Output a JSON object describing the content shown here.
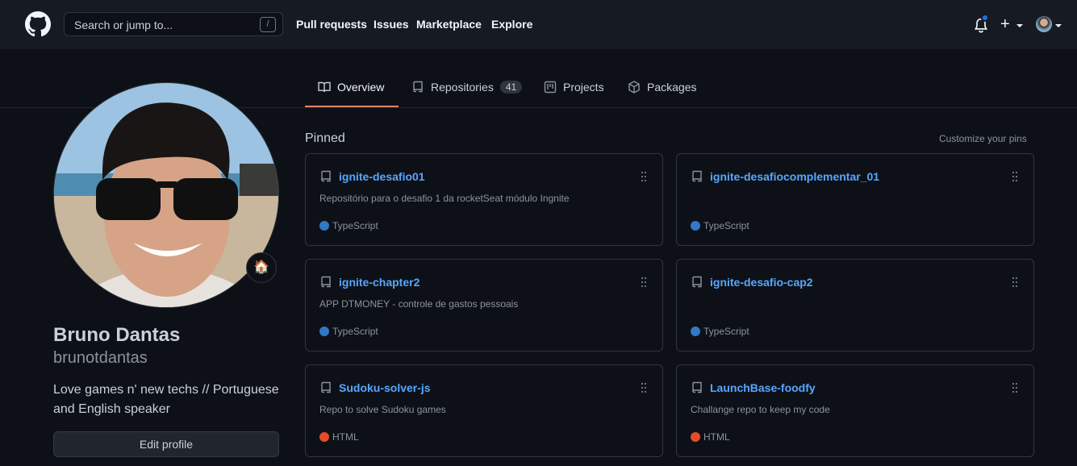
{
  "header": {
    "search_placeholder": "Search or jump to...",
    "search_shortcut": "/",
    "nav": [
      "Pull requests",
      "Issues",
      "Marketplace",
      "Explore"
    ],
    "plus_label": "+"
  },
  "tabs": [
    {
      "label": "Overview",
      "icon": "book-icon"
    },
    {
      "label": "Repositories",
      "icon": "repo-icon",
      "count": "41"
    },
    {
      "label": "Projects",
      "icon": "project-icon"
    },
    {
      "label": "Packages",
      "icon": "package-icon"
    }
  ],
  "profile": {
    "name": "Bruno Dantas",
    "login": "brunotdantas",
    "bio": "Love games n' new techs // Portuguese and English speaker",
    "edit_label": "Edit profile",
    "status_emoji": "🏠"
  },
  "pinned": {
    "title": "Pinned",
    "customize_label": "Customize your pins",
    "repos": [
      {
        "name": "ignite-desafio01",
        "description": "Repositório para o desafio 1 da rocketSeat módulo Ingnite",
        "language": "TypeScript",
        "color": "#3178c6"
      },
      {
        "name": "ignite-desafiocomplementar_01",
        "description": "",
        "language": "TypeScript",
        "color": "#3178c6"
      },
      {
        "name": "ignite-chapter2",
        "description": "APP DTMONEY - controle de gastos pessoais",
        "language": "TypeScript",
        "color": "#3178c6"
      },
      {
        "name": "ignite-desafio-cap2",
        "description": "",
        "language": "TypeScript",
        "color": "#3178c6"
      },
      {
        "name": "Sudoku-solver-js",
        "description": "Repo to solve Sudoku games",
        "language": "HTML",
        "color": "#e34c26"
      },
      {
        "name": "LaunchBase-foodfy",
        "description": "Challange repo to keep my code",
        "language": "HTML",
        "color": "#e34c26"
      }
    ]
  }
}
